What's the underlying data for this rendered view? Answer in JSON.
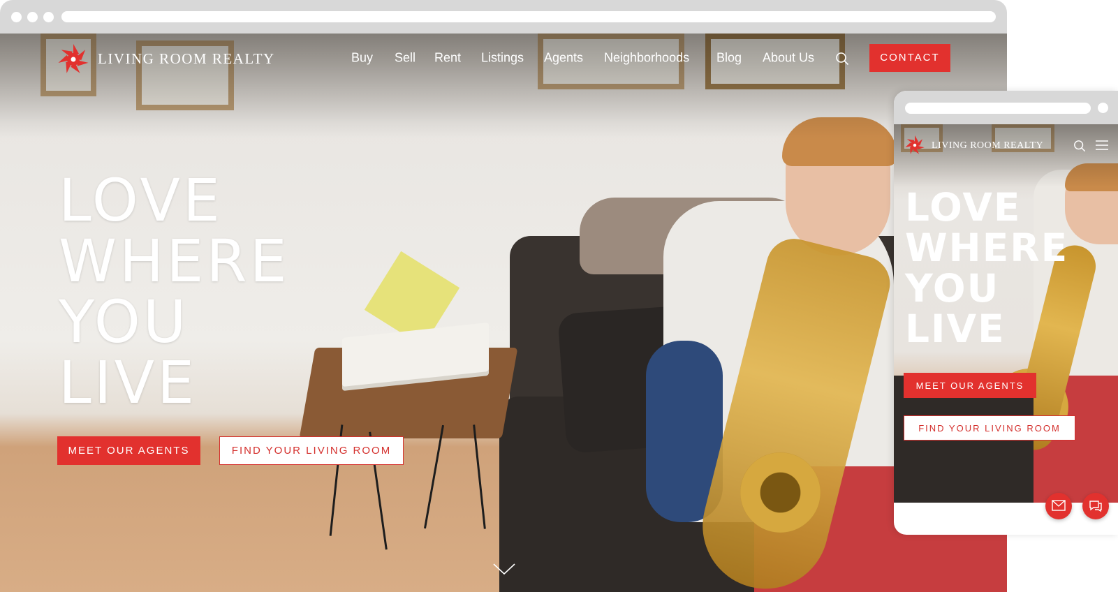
{
  "desktop": {
    "brand": "LIVING ROOM REALTY",
    "nav": [
      {
        "key": "buy",
        "label": "Buy"
      },
      {
        "key": "sell",
        "label": "Sell"
      },
      {
        "key": "rent",
        "label": "Rent"
      },
      {
        "key": "listings",
        "label": "Listings"
      },
      {
        "key": "agents",
        "label": "Agents"
      },
      {
        "key": "neighborhoods",
        "label": "Neighborhoods"
      },
      {
        "key": "blog",
        "label": "Blog"
      },
      {
        "key": "about",
        "label": "About Us"
      }
    ],
    "search_icon": "search-icon",
    "contact_label": "CONTACT",
    "hero": [
      "LOVE",
      "WHERE",
      "YOU",
      "LIVE"
    ],
    "primary_cta": "MEET OUR AGENTS",
    "secondary_cta": "FIND YOUR LIVING ROOM",
    "scroll_icon": "chevron-down-icon"
  },
  "mobile": {
    "brand": "LIVING ROOM REALTY",
    "hero": [
      "LOVE",
      "WHERE",
      "YOU",
      "LIVE"
    ],
    "primary_cta": "MEET OUR AGENTS",
    "secondary_cta": "FIND YOUR LIVING ROOM",
    "icons": [
      "search-icon",
      "hamburger-menu-icon",
      "mail-icon",
      "chat-icon"
    ]
  },
  "colors": {
    "accent": "#e2312e",
    "text_light": "#ffffff",
    "frame": "#d8d8d8"
  }
}
